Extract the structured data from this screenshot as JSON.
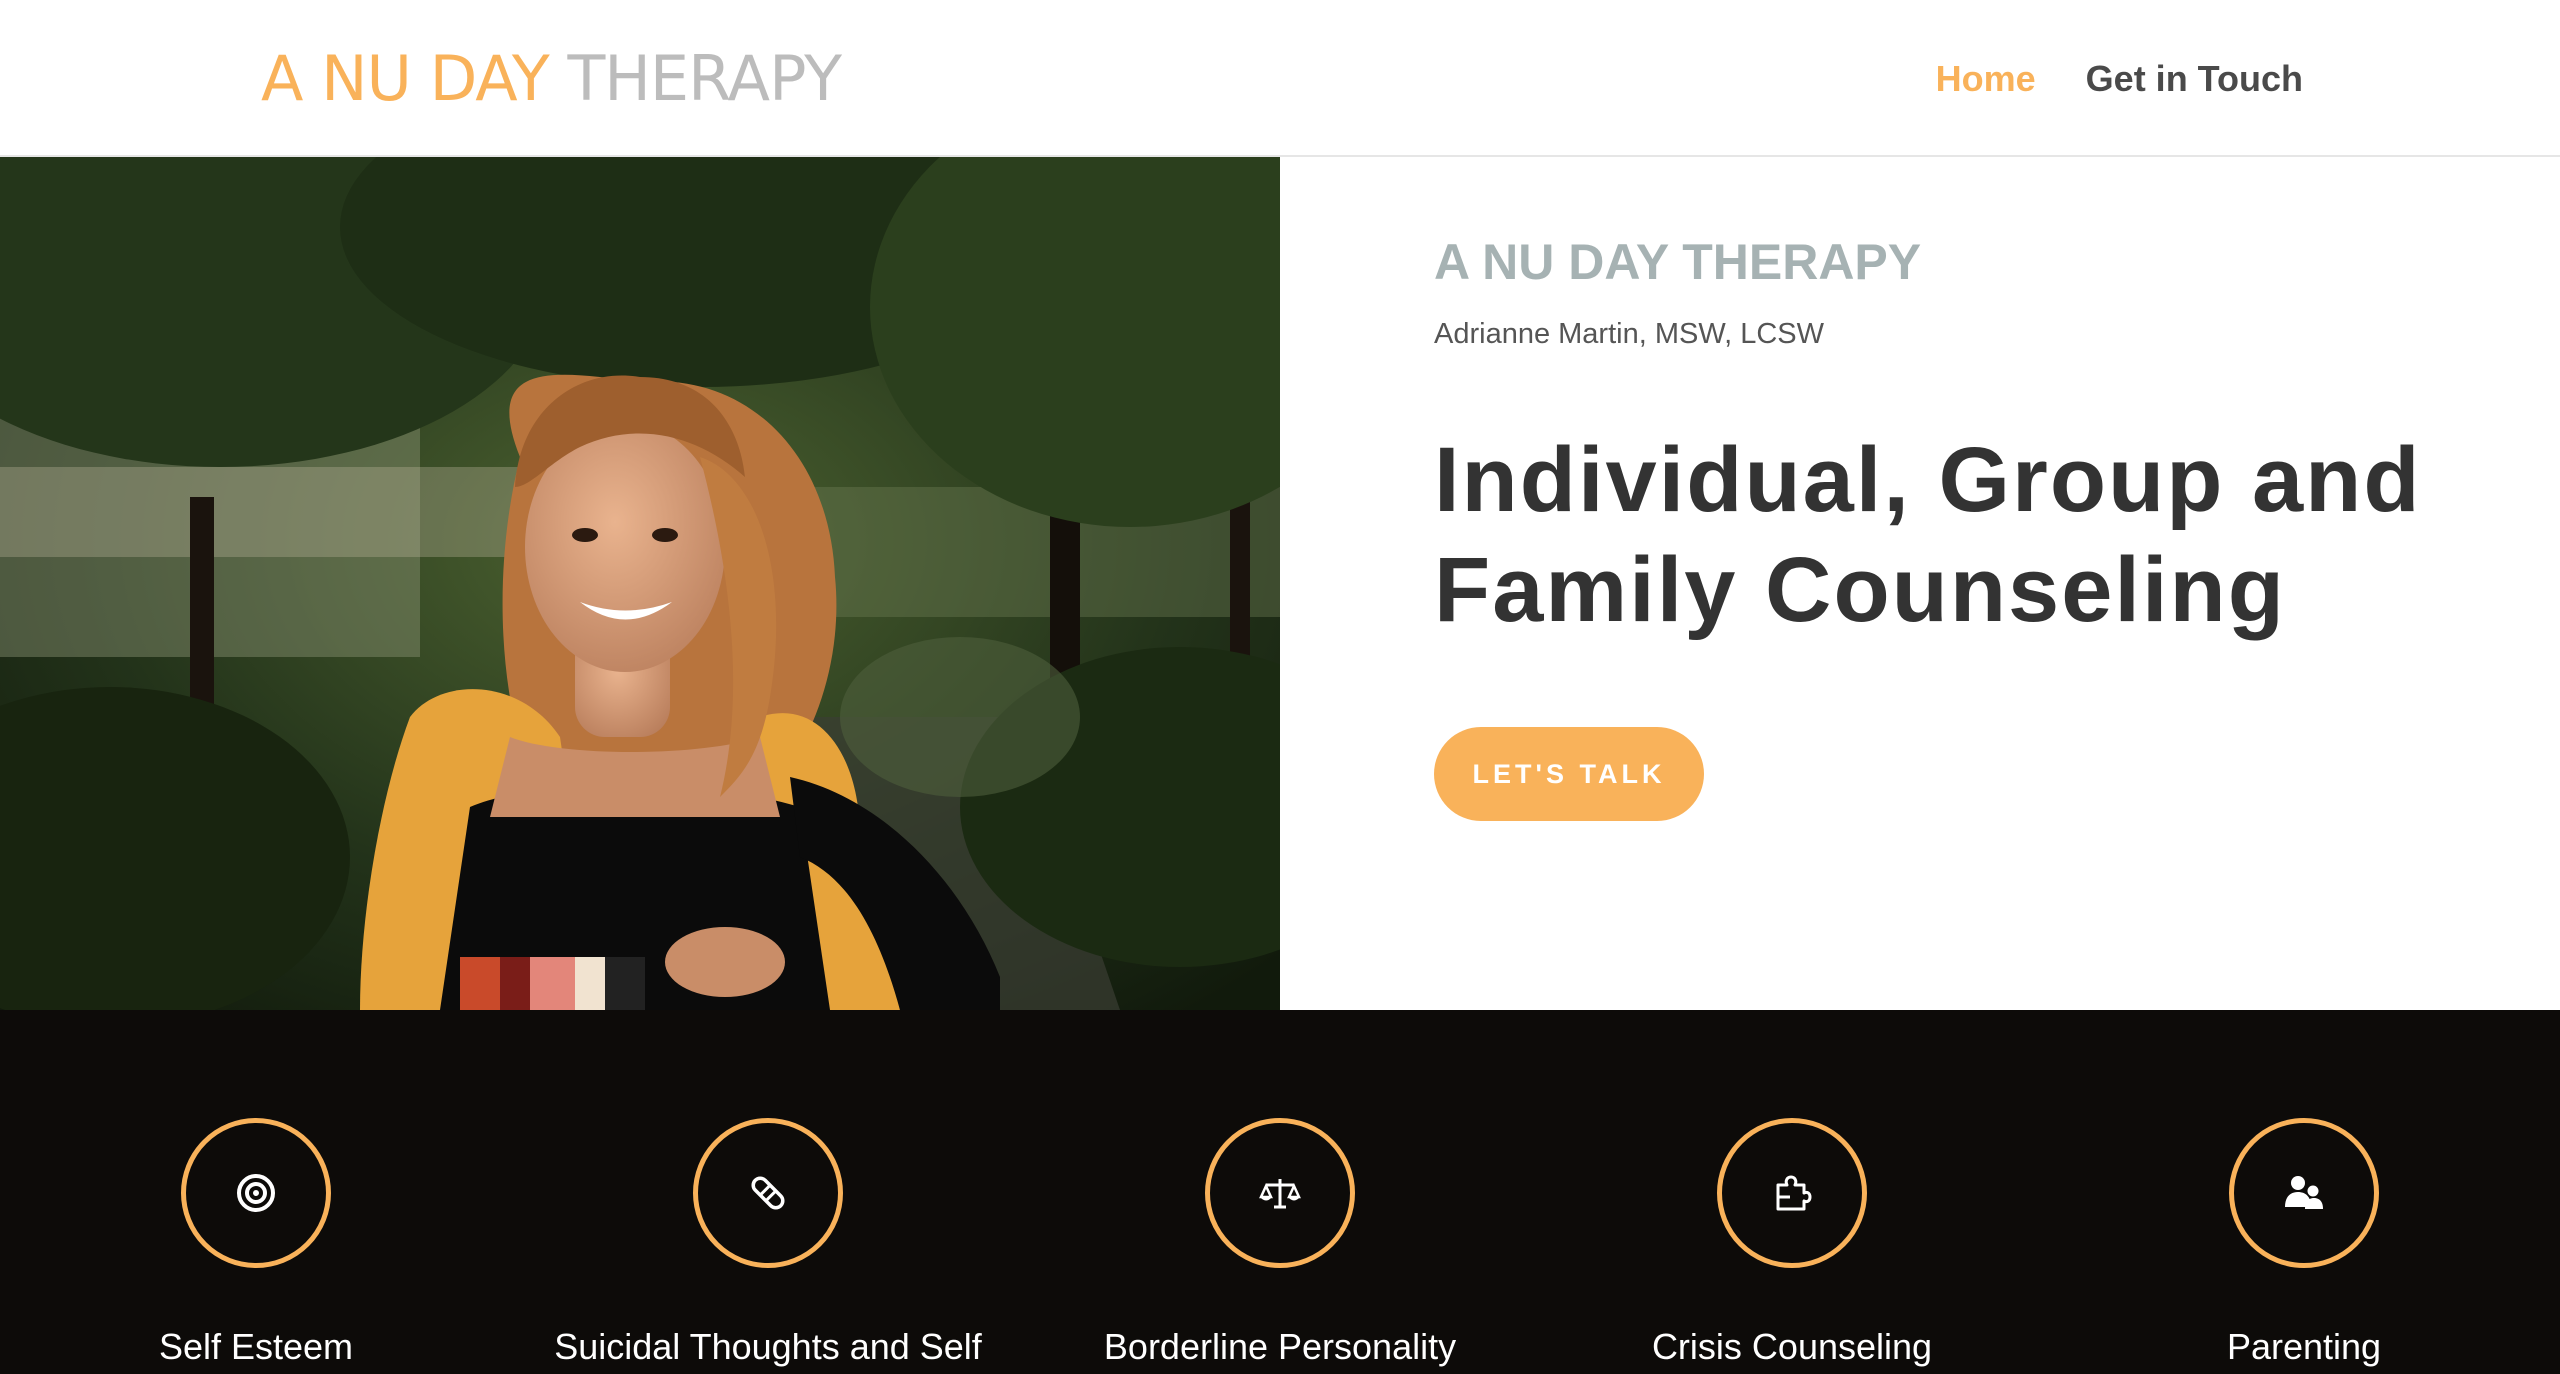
{
  "header": {
    "logo_part1": "A NU DAY",
    "logo_part2": "THERAPY",
    "nav": [
      {
        "label": "Home",
        "active": true
      },
      {
        "label": "Get in Touch",
        "active": false
      }
    ]
  },
  "hero": {
    "eyebrow": "A NU DAY THERAPY",
    "subline": "Adrianne Martin, MSW, LCSW",
    "headline": "Individual, Group and Family Counseling",
    "cta_label": "LET'S TALK",
    "photo_alt": "Smiling therapist with curly hair wearing a black top and mustard scarf, standing outdoors among trees"
  },
  "services": [
    {
      "label": "Self Esteem",
      "icon": "target-icon"
    },
    {
      "label": "Suicidal Thoughts and Self",
      "icon": "bandage-icon"
    },
    {
      "label": "Borderline Personality",
      "icon": "balance-scale-icon"
    },
    {
      "label": "Crisis Counseling",
      "icon": "puzzle-icon"
    },
    {
      "label": "Parenting",
      "icon": "people-icon"
    }
  ],
  "colors": {
    "accent": "#f9b25a",
    "logo_gray": "#bcbcbc",
    "eyebrow_gray": "#a6b2b3",
    "headline": "#333333",
    "band_bg": "#0d0b09"
  }
}
